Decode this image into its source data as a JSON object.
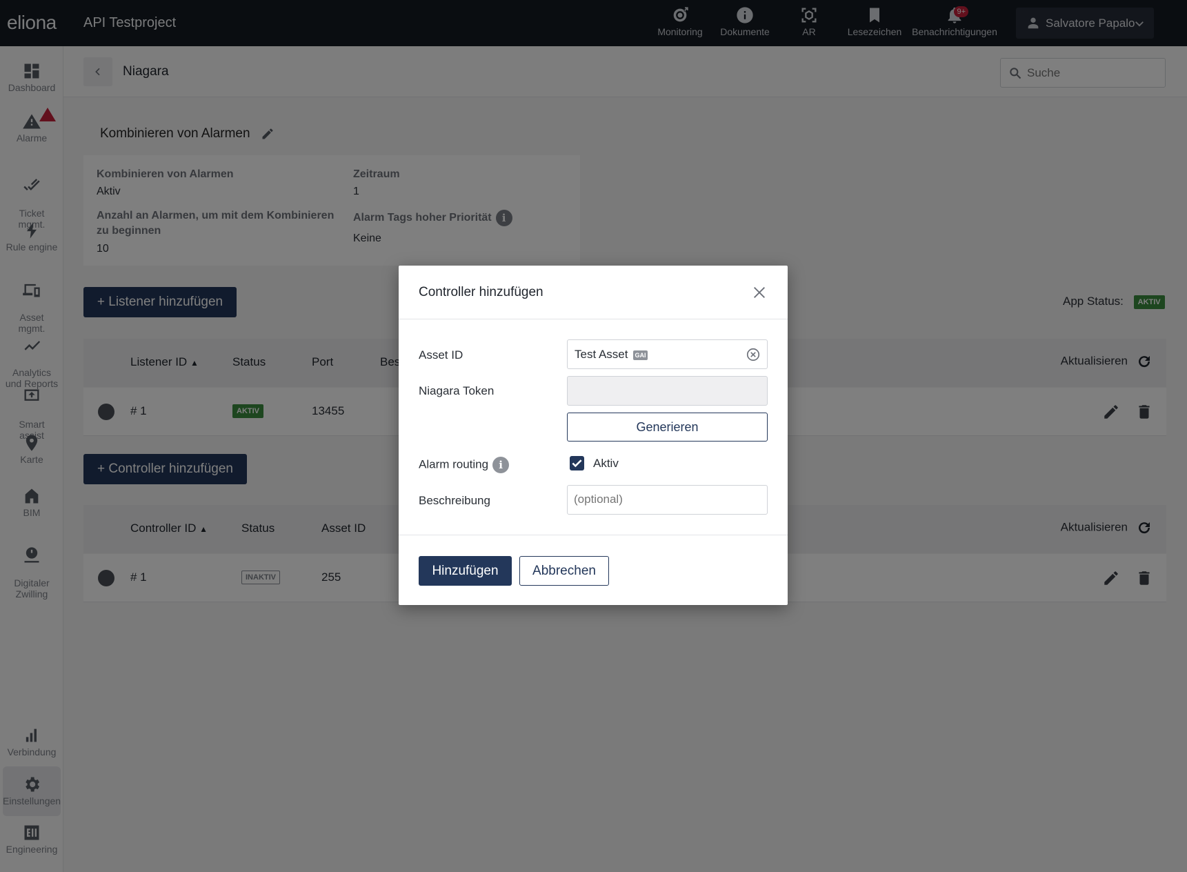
{
  "topbar": {
    "logo": "eliona",
    "project": "API Testproject",
    "nav": [
      {
        "label": "Monitoring",
        "icon": "monitoring-icon"
      },
      {
        "label": "Dokumente",
        "icon": "info-icon"
      },
      {
        "label": "AR",
        "icon": "ar-cube-icon"
      },
      {
        "label": "Lesezeichen",
        "icon": "bookmark-icon"
      },
      {
        "label": "Benachrichtigungen",
        "icon": "bell-icon",
        "badge": "9+"
      }
    ],
    "user": "Salvatore Papalo"
  },
  "sidebar": {
    "items": [
      {
        "label": "Dashboard",
        "icon": "dashboard-icon"
      },
      {
        "label": "Alarme",
        "icon": "alarm-icon"
      },
      {
        "label": "Ticket\nmgmt.",
        "icon": "ticket-icon"
      },
      {
        "label": "Rule engine",
        "icon": "bolt-icon"
      },
      {
        "label": "Asset\nmgmt.",
        "icon": "devices-icon"
      },
      {
        "label": "Analytics\nund Reports",
        "icon": "analytics-icon"
      },
      {
        "label": "Smart\nassist",
        "icon": "smart-assist-icon"
      },
      {
        "label": "Karte",
        "icon": "map-pin-icon"
      },
      {
        "label": "BIM",
        "icon": "building-icon"
      },
      {
        "label": "Digitaler\nZwilling",
        "icon": "digital-twin-icon"
      },
      {
        "label": "Verbindung",
        "icon": "bar-chart-icon"
      },
      {
        "label": "Einstellungen",
        "icon": "gear-icon"
      },
      {
        "label": "Engineering",
        "icon": "engineering-icon"
      }
    ]
  },
  "header": {
    "title": "Niagara",
    "search_placeholder": "Suche"
  },
  "section": {
    "title": "Kombinieren von Alarmen",
    "fields": {
      "combine_label": "Kombinieren von Alarmen",
      "combine_value": "Aktiv",
      "count_label": "Anzahl an Alarmen, um mit dem Kombinieren zu beginnen",
      "count_value": "10",
      "period_label": "Zeitraum",
      "period_value": "1",
      "tags_label": "Alarm Tags hoher Priorität",
      "tags_value": "Keine"
    }
  },
  "listener": {
    "add_button": "+ Listener hinzufügen",
    "app_status_label": "App Status:",
    "app_status_value": "AKTIV",
    "columns": [
      "Listener ID",
      "Status",
      "Port",
      "Bes"
    ],
    "refresh": "Aktualisieren",
    "rows": [
      {
        "id": "# 1",
        "status": "AKTIV",
        "port": "13455"
      }
    ]
  },
  "controller": {
    "add_button": "+ Controller hinzufügen",
    "columns": [
      "Controller ID",
      "Status",
      "Asset ID"
    ],
    "refresh": "Aktualisieren",
    "rows": [
      {
        "id": "# 1",
        "status": "INAKTIV",
        "asset": "255"
      }
    ]
  },
  "modal": {
    "title": "Controller hinzufügen",
    "asset_label": "Asset ID",
    "asset_value": "Test Asset",
    "asset_tag": "GAI",
    "token_label": "Niagara Token",
    "token_value": "",
    "generate_button": "Generieren",
    "routing_label": "Alarm routing",
    "routing_checkbox_label": "Aktiv",
    "routing_checked": true,
    "description_label": "Beschreibung",
    "description_placeholder": "(optional)",
    "add_button": "Hinzufügen",
    "cancel_button": "Abbrechen"
  }
}
